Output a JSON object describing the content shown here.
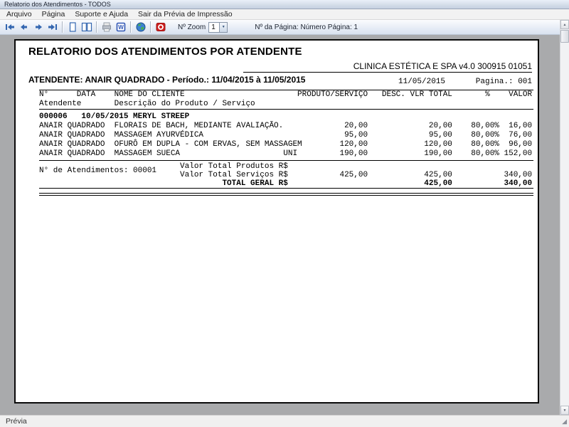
{
  "window": {
    "title": "Relatorio dos Atendimentos - TODOS"
  },
  "menu": {
    "items": [
      "Arquivo",
      "Página",
      "Suporte e Ajuda",
      "Sair da Prévia de Impressão"
    ]
  },
  "toolbar": {
    "zoom_label": "Nº Zoom",
    "zoom_value": "1",
    "page_info": "Nº da Página: Número Página: 1"
  },
  "statusbar": {
    "text": "Prévia"
  },
  "report": {
    "title": "RELATORIO DOS ATENDIMENTOS POR ATENDENTE",
    "clinic": "CLINICA ESTÉTICA E SPA v4.0 300915 01051",
    "attendant": "ATENDENTE: ANAIR QUADRADO - Período.: 11/04/2015 à 11/05/2015",
    "date": "11/05/2015",
    "page_number": "Pagina.: 001",
    "table": {
      "header1": "N°      DATA    NOME DO CLIENTE                        PRODUTO/SERVIÇO   DESC. VLR TOTAL       %    VALOR",
      "header2": "Atendente       Descrição do Produto / Serviço",
      "group_row": "000006   10/05/2015 MERYL STREEP",
      "rows": [
        "ANAIR QUADRADO  FLORAIS DE BACH, MEDIANTE AVALIAÇÃO.             20,00             20,00    80,00%  16,00",
        "ANAIR QUADRADO  MASSAGEM AYURVÉDICA                              95,00             95,00    80,00%  76,00",
        "ANAIR QUADRADO  OFURÔ EM DUPLA - COM ERVAS, SEM MASSAGEM        120,00            120,00    80,00%  96,00",
        "ANAIR QUADRADO  MASSAGEM SUECA                      UNI         190,00            190,00    80,00% 152,00"
      ],
      "attendances_count": "N° de Atendimentos: 00001",
      "total_products": "                              Valor Total Produtos R$",
      "total_services": "                              Valor Total Serviços R$           425,00            425,00           340,00",
      "total_general": "                                       TOTAL GERAL R$                             425,00           340,00"
    }
  }
}
